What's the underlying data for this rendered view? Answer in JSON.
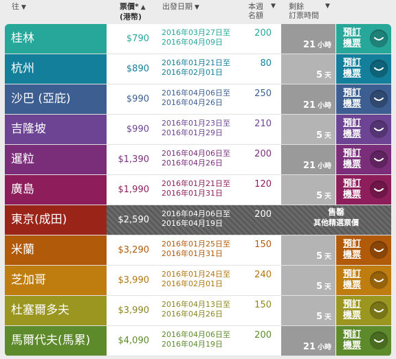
{
  "header": {
    "destination": "往",
    "price": "票價*",
    "price_unit": "(港幣)",
    "travel_dates": "出發日期",
    "seats_line1": "本週",
    "seats_line2": "名額",
    "remaining_line1": "剩餘",
    "remaining_line2": "訂票時間",
    "sort_arrow_down": "▼",
    "sort_arrow_up": "▲"
  },
  "book_label_line1": "預訂",
  "book_label_line2": "機票",
  "rows": [
    {
      "city": "桂林",
      "price": "$790",
      "date_from": "2016年03月27日至",
      "date_to": "2016年04月09日",
      "seats": "200",
      "remaining_num": "21",
      "remaining_unit": "小時",
      "color": "#26a79a",
      "price_color": "#26a79a",
      "date_color": "#26a79a",
      "seat_color": "#26a79a",
      "button_icon": "smile-icon"
    },
    {
      "city": "杭州",
      "price": "$890",
      "date_from": "2016年01月21日至",
      "date_to": "2016年02月01日",
      "seats": "80",
      "remaining_num": "5",
      "remaining_unit": "天",
      "color": "#137f9a",
      "price_color": "#137f9a",
      "date_color": "#137f9a",
      "seat_color": "#137f9a",
      "button_icon": "smile-icon"
    },
    {
      "city": "沙巴 (亞庇)",
      "price": "$990",
      "date_from": "2016年04月06日至",
      "date_to": "2016年04月26日",
      "seats": "250",
      "remaining_num": "21",
      "remaining_unit": "小時",
      "color": "#3c5e91",
      "price_color": "#3c5e91",
      "date_color": "#3c5e91",
      "seat_color": "#3c5e91",
      "button_icon": "smile-icon"
    },
    {
      "city": "吉隆坡",
      "price": "$990",
      "date_from": "2016年01月23日至",
      "date_to": "2016年01月29日",
      "seats": "210",
      "remaining_num": "5",
      "remaining_unit": "天",
      "color": "#6c4493",
      "price_color": "#6c4493",
      "date_color": "#6c4493",
      "seat_color": "#6c4493",
      "button_icon": "smile-icon"
    },
    {
      "city": "暹粒",
      "price": "$1,390",
      "date_from": "2016年04月06日至",
      "date_to": "2016年04月26日",
      "seats": "200",
      "remaining_num": "21",
      "remaining_unit": "小時",
      "color": "#7a2e7a",
      "price_color": "#7a2e7a",
      "date_color": "#7a2e7a",
      "seat_color": "#7a2e7a",
      "button_icon": "smile-icon"
    },
    {
      "city": "廣島",
      "price": "$1,990",
      "date_from": "2016年01月21日至",
      "date_to": "2016年01月31日",
      "seats": "120",
      "remaining_num": "5",
      "remaining_unit": "天",
      "color": "#8e1d5c",
      "price_color": "#8e1d5c",
      "date_color": "#8e1d5c",
      "seat_color": "#8e1d5c",
      "button_icon": "smile-icon"
    },
    {
      "city": "米蘭",
      "price": "$3,290",
      "date_from": "2016年01月25日至",
      "date_to": "2016年01月31日",
      "seats": "150",
      "remaining_num": "5",
      "remaining_unit": "天",
      "color": "#b05a0a",
      "price_color": "#b05a0a",
      "date_color": "#b05a0a",
      "seat_color": "#b05a0a",
      "button_icon": "smile-icon"
    },
    {
      "city": "芝加哥",
      "price": "$3,990",
      "date_from": "2016年01月24日至",
      "date_to": "2016年02月01日",
      "seats": "240",
      "remaining_num": "5",
      "remaining_unit": "天",
      "color": "#c07d0f",
      "price_color": "#b0750f",
      "date_color": "#b0750f",
      "seat_color": "#b0750f",
      "button_icon": "smile-icon"
    },
    {
      "city": "杜塞爾多夫",
      "price": "$3,990",
      "date_from": "2016年04月13日至",
      "date_to": "2016年04月26日",
      "seats": "150",
      "remaining_num": "5",
      "remaining_unit": "天",
      "color": "#9b9620",
      "price_color": "#8a8520",
      "date_color": "#8a8520",
      "seat_color": "#8a8520",
      "button_icon": "smile-icon"
    },
    {
      "city": "馬爾代夫(馬累)",
      "price": "$4,090",
      "date_from": "2016年04月06日至",
      "date_to": "2016年04月19日",
      "seats": "200",
      "remaining_num": "21",
      "remaining_unit": "小時",
      "color": "#5d8a2a",
      "price_color": "#5d8a2a",
      "date_color": "#5d8a2a",
      "seat_color": "#5d8a2a",
      "button_icon": "smile-icon"
    }
  ],
  "sold_out_row": {
    "city": "東京(成田)",
    "price": "$2,590",
    "date_from": "2016年04月06日至",
    "date_to": "2016年04月19日",
    "seats": "200",
    "status": "售罄",
    "alternative": "其他精選票價",
    "color": "#9b2418",
    "button_icon": "smile-icon"
  }
}
